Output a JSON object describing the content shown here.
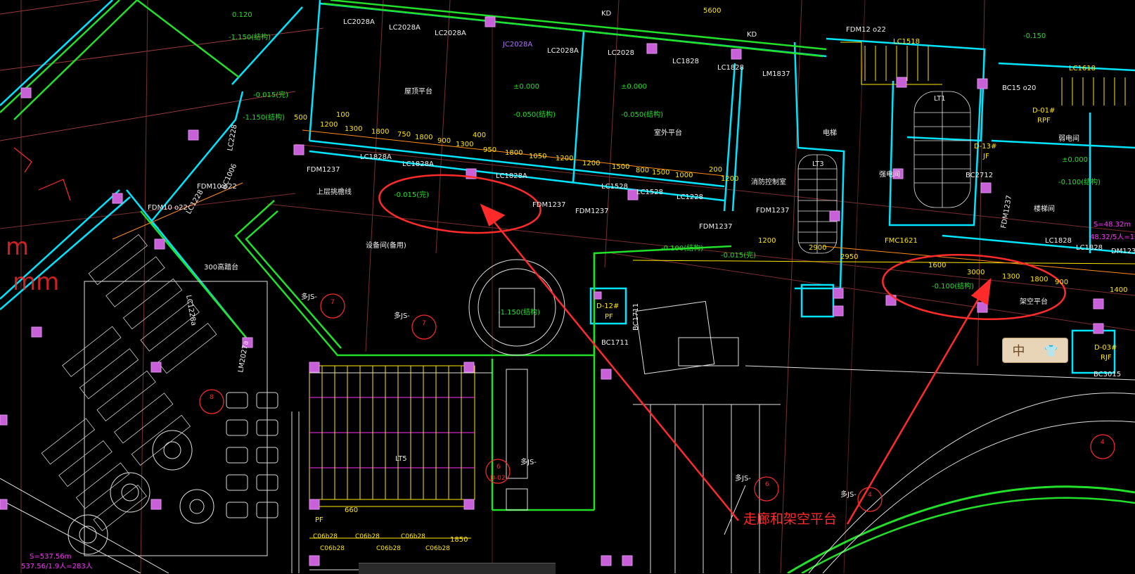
{
  "colors": {
    "background": "#000000",
    "annotation": "#ff2a2a",
    "wall": "#00e5ff",
    "green": "#22e02a",
    "yellow": "#ffe600",
    "orange": "#ff8a1a",
    "magenta": "#ff33ff",
    "white": "#f0f0f0"
  },
  "annotation": {
    "caption": "走廊和架空平台"
  },
  "ime": {
    "label": "中",
    "icon": "shirt-icon"
  },
  "labels": {
    "lc2028a_1": "LC2028A",
    "lc2028a_2": "LC2028A",
    "lc2028a_3": "LC2028A",
    "jc2028a": "JC2028A",
    "lc2028a_4": "LC2028A",
    "lc2028": "LC2028",
    "lc1828_1": "LC1828",
    "lc1828_2": "LC1828",
    "lm1837": "LM1837",
    "fdm12": "FDM12 o22",
    "lc1518": "LC1518",
    "lc1618": "LC1618",
    "kd_1": "KD",
    "kd_2": "KD",
    "n5600": "5600",
    "lc1828a_1": "LC1828A",
    "lc1828a_2": "LC1828A",
    "lc1828a_3": "LC1828A",
    "lc1528_1": "LC1528",
    "lc1528_2": "LC1528",
    "lc1228": "LC1228",
    "fdm1237_1": "FDM1237",
    "fdm1237_2": "FDM1237",
    "fdm1237_3": "FDM1237",
    "fdm1237_4": "FDM1237",
    "fdm1237_5": "FDM1237",
    "fdm1237_6": "FDM1237",
    "lc1828_3": "LC1828",
    "lc1828_4": "LC1828",
    "dm1237": "DM1237",
    "elev_0_1": "±0.000",
    "elev_0_2": "±0.000",
    "elev_0_3": "±0.000",
    "elev_050_1": "-0.050(结构)",
    "elev_050_2": "-0.050(结构)",
    "elev_015": "-0.015(完)",
    "elev_015b": "-0.015(完)",
    "elev_015c": "-0.015(完)",
    "elev_100_1": "-0.100(结构)",
    "elev_100_2": "-0.100(结构)",
    "elev_100_3": "-0.100(结构)",
    "elev_150_1": "-1.150(结构)",
    "elev_150_2": "-1.150(结构)",
    "elev_150_3": "-0.150",
    "elev_150_4": "-1.150(结构)",
    "elev_0120": "0.120",
    "d_1200": "1200",
    "d_1300": "1300",
    "d_1800_1": "1800",
    "d_750": "750",
    "d_1800_2": "1800",
    "d_900": "900",
    "d_1300_2": "1300",
    "d_400": "400",
    "d_950": "950",
    "d_1800_3": "1800",
    "d_1050": "1050",
    "d_1200_2": "1200",
    "d_1200_3": "1200",
    "d_1500": "1500",
    "d_800": "800",
    "d_1500_2": "1500",
    "d_1000": "1000",
    "d_1200_4": "1200",
    "d_200": "200",
    "d_100": "100",
    "d_500": "500",
    "d_3000": "3000",
    "d_1300_3": "1300",
    "d_1800_4": "1800",
    "d_900_2": "900",
    "d_1600": "1600",
    "d_2950": "2950",
    "d_1400": "1400",
    "d_2900": "2900",
    "d_1200_5": "1200",
    "d_1850": "1850",
    "lt1": "LT1",
    "lt3": "LT3",
    "lt5": "LT5",
    "d01": "D-01#",
    "rpf": "RPF",
    "d13": "D-13#",
    "jf": "JF",
    "d12": "D-12#",
    "pf": "PF",
    "d03": "D-03#",
    "rjf": "RJF",
    "pf2": "PF",
    "bc1711": "BC1711",
    "bc1711b": "BC1711",
    "bc2712": "BC2712",
    "bc3015": "BC3015",
    "bc15": "BC15 o20",
    "fmc1621": "FMC1621",
    "fdm1022_1": "FDM10 o22",
    "fdm1022_2": "FDM10 o22",
    "lc1228b": "LC1228",
    "lc2228": "LC2228",
    "bc1006": "BC1006",
    "lm2027": "LM2027a",
    "lc1228c": "LC1228a",
    "mark7": "7",
    "mark7b": "7",
    "markd02": "D-02",
    "mark6": "6",
    "mark6b": "6",
    "mark4": "4",
    "mark4b": "4",
    "mark8": "8",
    "jsx": "多JS-",
    "jsx2": "多JS-",
    "jsx3": "多JS-",
    "jsx4": "多JS-",
    "jsx5": "多JS-",
    "area1": "S=537.56m",
    "area2": "537.56/1.9人=283人",
    "area3": "S=48.32m",
    "area4": "48.32/5人=10人",
    "mm": "mm",
    "m2": "m",
    "rm_1": "屋顶平台",
    "rm_2": "室外平台",
    "rm_3": "架空平台",
    "rm_4": "上层挑檐线",
    "rm_5": "设备间(备用)",
    "rm_6": "楼梯间",
    "rm_7": "电梯",
    "rm_8": "消防控制室",
    "rm_9": "强电间",
    "rm_10": "弱电间",
    "rm_11": "300高踏台",
    "d_660": "660",
    "c0": "C06b28"
  }
}
